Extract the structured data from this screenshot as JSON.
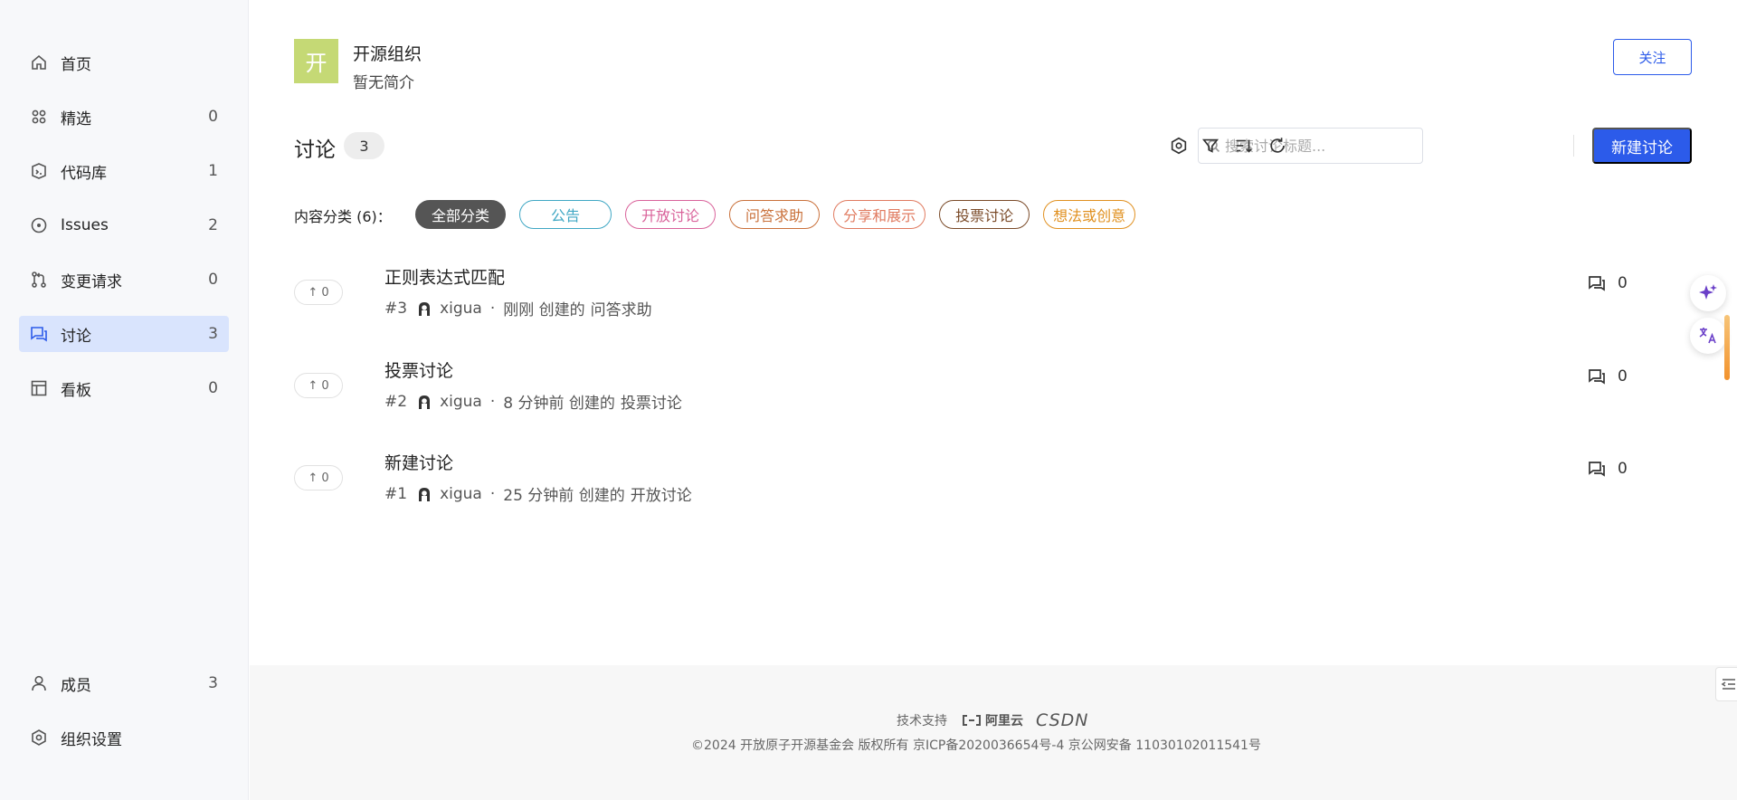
{
  "sidebar": {
    "items": [
      {
        "label": "首页",
        "count": "",
        "icon": "home-icon"
      },
      {
        "label": "精选",
        "count": "0",
        "icon": "grid-icon"
      },
      {
        "label": "代码库",
        "count": "1",
        "icon": "repository-icon"
      },
      {
        "label": "Issues",
        "count": "2",
        "icon": "issue-icon"
      },
      {
        "label": "变更请求",
        "count": "0",
        "icon": "pull-request-icon"
      },
      {
        "label": "讨论",
        "count": "3",
        "icon": "discussion-icon",
        "active": true
      },
      {
        "label": "看板",
        "count": "0",
        "icon": "board-icon"
      }
    ],
    "bottom_items": [
      {
        "label": "成员",
        "count": "3",
        "icon": "member-icon"
      },
      {
        "label": "组织设置",
        "count": "",
        "icon": "settings-icon"
      }
    ]
  },
  "org": {
    "avatar_text": "开",
    "name": "开源组织",
    "description": "暂无简介",
    "follow_label": "关注"
  },
  "discussions": {
    "title": "讨论",
    "count": "3",
    "search_placeholder": "搜索讨论标题...",
    "new_button": "新建讨论",
    "category_label": "内容分类 (6)：",
    "categories": [
      {
        "label": "全部分类",
        "color": "#555555",
        "active": true
      },
      {
        "label": "公告",
        "color": "#3fa7c4"
      },
      {
        "label": "开放讨论",
        "color": "#d9629a"
      },
      {
        "label": "问答求助",
        "color": "#c9703a"
      },
      {
        "label": "分享和展示",
        "color": "#e07a5f"
      },
      {
        "label": "投票讨论",
        "color": "#7a4a28"
      },
      {
        "label": "想法或创意",
        "color": "#e0901f"
      }
    ],
    "items": [
      {
        "title": "正则表达式匹配",
        "number": "#3",
        "author": "xigua",
        "separator": "·",
        "time": "刚刚 创建的",
        "category": "问答求助",
        "votes": "↑ 0",
        "comments": "0"
      },
      {
        "title": "投票讨论",
        "number": "#2",
        "author": "xigua",
        "separator": "·",
        "time": "8 分钟前 创建的",
        "category": "投票讨论",
        "votes": "↑ 0",
        "comments": "0"
      },
      {
        "title": "新建讨论",
        "number": "#1",
        "author": "xigua",
        "separator": "·",
        "time": "25 分钟前 创建的",
        "category": "开放讨论",
        "votes": "↑ 0",
        "comments": "0"
      }
    ]
  },
  "footer": {
    "support_label": "技术支持",
    "aliyun": "阿里云",
    "csdn": "CSDN",
    "copyright": "©2024 开放原子开源基金会 版权所有  京ICP备2020036654号-4  京公网安备 11030102011541号"
  },
  "colors": {
    "accent": "#2c5bea",
    "active_nav": "#d9e4fd",
    "avatar_bg": "#c5d975"
  }
}
